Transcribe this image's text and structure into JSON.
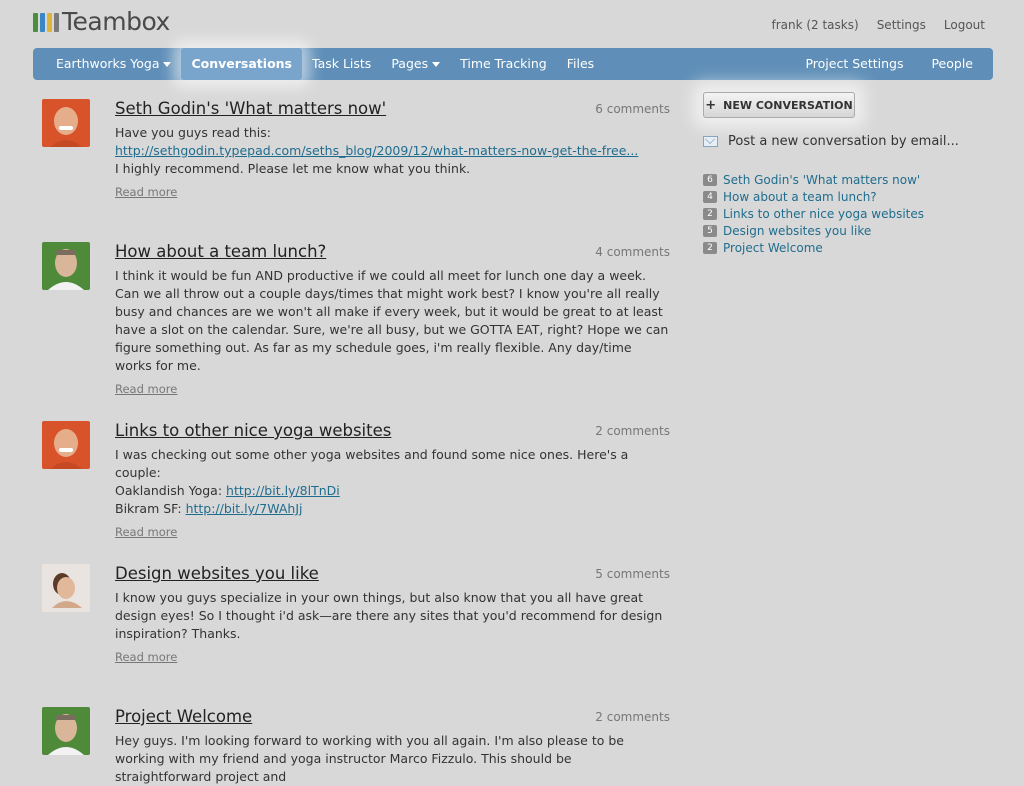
{
  "app": {
    "logo_text": "Teambox",
    "logo_colors": [
      "#4a8f3c",
      "#3b86c4",
      "#e0b43a",
      "#7a7a7a"
    ]
  },
  "top_links": {
    "user": "frank (2 tasks)",
    "settings": "Settings",
    "logout": "Logout"
  },
  "nav": {
    "project": "Earthworks Yoga",
    "conversations": "Conversations",
    "task_lists": "Task Lists",
    "pages": "Pages",
    "time_tracking": "Time Tracking",
    "files": "Files",
    "project_settings": "Project Settings",
    "people": "People"
  },
  "conversations": [
    {
      "title": "Seth Godin's 'What matters now'",
      "comments": "6 comments",
      "line1": "Have you guys read this:",
      "link": "http://sethgodin.typepad.com/seths_blog/2009/12/what-matters-now-get-the-free...",
      "line2": "I highly recommend. Please let me know what you think.",
      "read_more": "Read more"
    },
    {
      "title": "How about a team lunch?",
      "comments": "4 comments",
      "text": "I think it would be fun AND productive if we could all meet for lunch one day a week. Can we all throw out a couple days/times that might work best? I know you're all really busy and chances are we won't all make if every week, but it would be great to at least have a slot on the calendar. Sure, we're all busy, but we GOTTA EAT, right? Hope we can figure something out. As far as my schedule goes, i'm really flexible. Any day/time works for me.",
      "read_more": "Read more"
    },
    {
      "title": "Links to other nice yoga websites",
      "comments": "2 comments",
      "line1": "I was checking out some other yoga websites and found some nice ones. Here's a couple:",
      "l2_label": "Oaklandish Yoga: ",
      "l2_link": "http://bit.ly/8lTnDi",
      "l3_label": "Bikram SF: ",
      "l3_link": "http://bit.ly/7WAhJj",
      "read_more": "Read more"
    },
    {
      "title": "Design websites you like",
      "comments": "5 comments",
      "text": "I know you guys specialize in your own things, but also know that you all have great design eyes! So I thought i'd ask—are there any sites that you'd recommend for design inspiration? Thanks.",
      "read_more": "Read more"
    },
    {
      "title": "Project Welcome",
      "comments": "2 comments",
      "text": "Hey guys. I'm looking forward to working with you all again. I'm also please to be working with my friend and yoga instructor Marco Fizzulo. This should be straightforward project and"
    }
  ],
  "sidebar": {
    "new_conversation": "NEW CONVERSATION",
    "email_post": "Post a new conversation by email...",
    "items": [
      {
        "count": "6",
        "label": "Seth Godin's 'What matters now'"
      },
      {
        "count": "4",
        "label": "How about a team lunch?"
      },
      {
        "count": "2",
        "label": "Links to other nice yoga websites"
      },
      {
        "count": "5",
        "label": "Design websites you like"
      },
      {
        "count": "2",
        "label": "Project Welcome"
      }
    ]
  }
}
